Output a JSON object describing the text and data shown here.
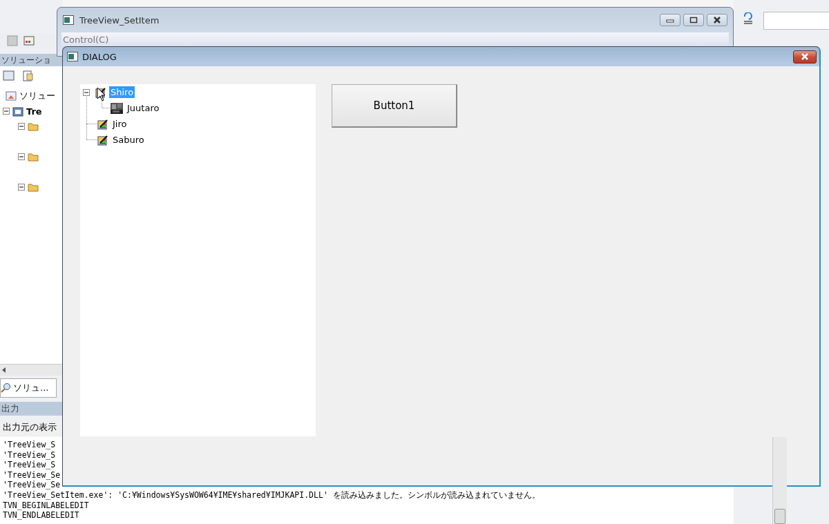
{
  "ide": {
    "solution_panel_title": "ソリューショ",
    "solution_root": "ソリュー",
    "project": "Tre",
    "solution_tab": "ソリュ...",
    "output_title": "出力",
    "output_source_label": "出力元の表示",
    "output_lines": [
      "'TreeView_S",
      "'TreeView_S",
      "'TreeView_S",
      "'TreeView_Se",
      "'TreeView_Se",
      "'TreeView_SetItem.exe': 'C:¥Windows¥SysWOW64¥IME¥shared¥IMJKAPI.DLL' を読み込みました。シンボルが読み込まれていません。",
      "TVN_BEGINLABELEDIT",
      "TVN_ENDLABELEDIT"
    ]
  },
  "app_window": {
    "title": "TreeView_SetItem",
    "menu": [
      {
        "label": "Control(C)"
      }
    ]
  },
  "dialog": {
    "title": "DIALOG",
    "tree": [
      {
        "label": "Shiro",
        "selected": true,
        "expanded": true,
        "kind": "pencil",
        "children": [
          {
            "label": "Juutaro",
            "selected": false,
            "kind": "photo"
          }
        ]
      },
      {
        "label": "Jiro",
        "selected": false,
        "kind": "pencil"
      },
      {
        "label": "Saburo",
        "selected": false,
        "kind": "pencil"
      }
    ],
    "button": "Button1"
  }
}
